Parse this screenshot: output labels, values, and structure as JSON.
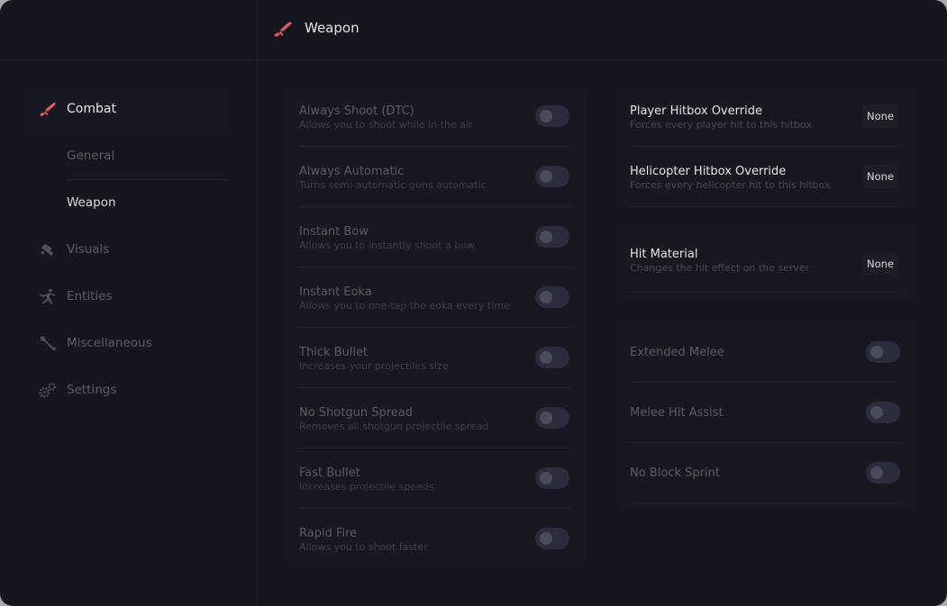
{
  "header": {
    "title": "Weapon",
    "icon": "rifle-icon"
  },
  "colors": {
    "accent": "#e05a5a",
    "background": "#151620",
    "panel": "#171822",
    "toggle_off": "#2b2d3c"
  },
  "sidebar": {
    "items": [
      {
        "label": "Combat",
        "icon": "rifle-icon",
        "active": true
      },
      {
        "label": "General",
        "sub": true
      },
      {
        "label": "Weapon",
        "sub": true,
        "selected": true
      },
      {
        "label": "Visuals",
        "icon": "paint-icon"
      },
      {
        "label": "Entities",
        "icon": "runner-icon"
      },
      {
        "label": "Miscellaneous",
        "icon": "wrench-icon"
      },
      {
        "label": "Settings",
        "icon": "gears-icon"
      }
    ]
  },
  "left_panel": {
    "toggles": [
      {
        "name": "Always Shoot (DTC)",
        "description": "Allows you to shoot while in the air",
        "enabled": false
      },
      {
        "name": "Always Automatic",
        "description": "Turns semi-automatic guns automatic",
        "enabled": false
      },
      {
        "name": "Instant Bow",
        "description": "Allows you to instantly shoot a bow",
        "enabled": false
      },
      {
        "name": "Instant Eoka",
        "description": "Allows you to one-tap the eoka every time",
        "enabled": false
      },
      {
        "name": "Thick Bullet",
        "description": "Increases your projectiles size",
        "enabled": false
      },
      {
        "name": "No Shotgun Spread",
        "description": "Removes all shotgun projectile spread",
        "enabled": false
      },
      {
        "name": "Fast Bullet",
        "description": "Increases projectile speeds",
        "enabled": false
      },
      {
        "name": "Rapid Fire",
        "description": "Allows you to shoot faster",
        "enabled": false
      }
    ]
  },
  "right_panel_top": {
    "selects": [
      {
        "name": "Player Hitbox Override",
        "description": "Forces every player hit to this hitbox",
        "value": "None"
      },
      {
        "name": "Helicopter Hitbox Override",
        "description": "Forces every helicopter hit to this hitbox",
        "value": "None"
      }
    ]
  },
  "right_panel_mid": {
    "selects": [
      {
        "name": "Hit Material",
        "description": "Changes the hit effect on the server",
        "value": "None"
      }
    ]
  },
  "right_panel_bottom": {
    "toggles": [
      {
        "name": "Extended Melee",
        "enabled": false
      },
      {
        "name": "Melee Hit Assist",
        "enabled": false
      },
      {
        "name": "No Block Sprint",
        "enabled": false
      }
    ]
  }
}
